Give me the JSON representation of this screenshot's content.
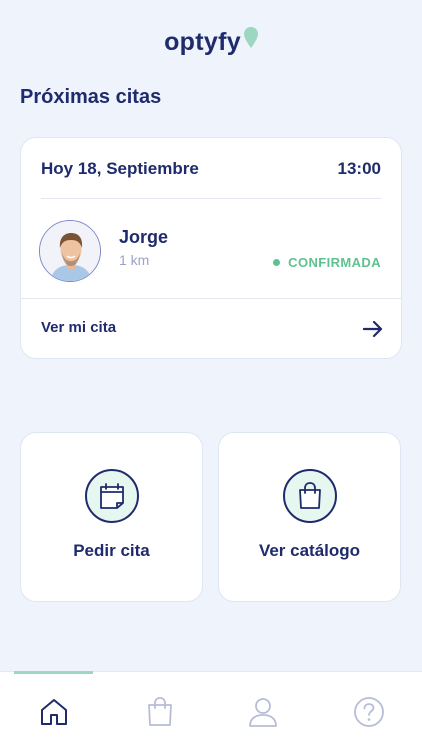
{
  "brand": {
    "name": "optyfy"
  },
  "section_title": "Próximas citas",
  "appointment": {
    "date": "Hoy 18, Septiembre",
    "time": "13:00",
    "person_name": "Jorge",
    "distance": "1 km",
    "status": "CONFIRMADA",
    "see_label": "Ver mi cita"
  },
  "actions": {
    "book_label": "Pedir cita",
    "catalog_label": "Ver catálogo"
  },
  "tabs": [
    "home-icon",
    "shopping-bag-icon",
    "profile-icon",
    "help-icon"
  ],
  "colors": {
    "navy": "#1f2b6c",
    "background": "#eef3fc",
    "confirmed_green": "#5fc28e",
    "mint": "#9ed7c0"
  }
}
